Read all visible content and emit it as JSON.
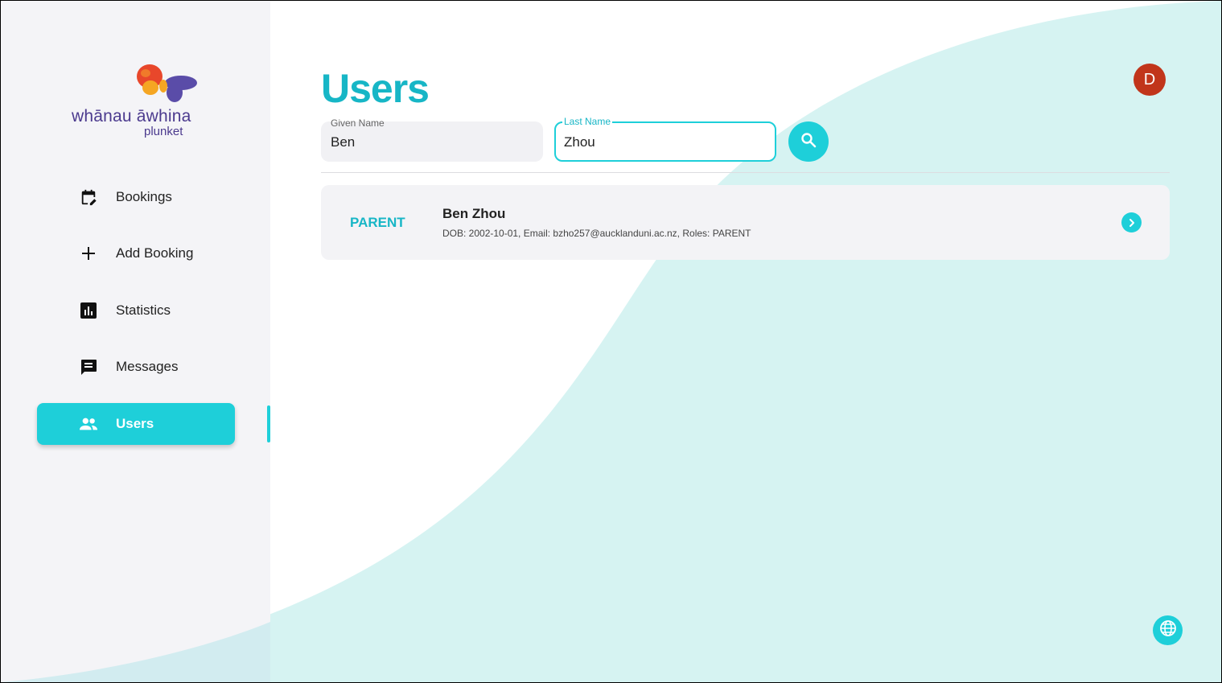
{
  "brand": {
    "line1": "whānau āwhina",
    "line2": "plunket"
  },
  "sidebar": {
    "items": [
      {
        "label": "Bookings",
        "icon": "calendar-edit-icon"
      },
      {
        "label": "Add Booking",
        "icon": "plus-icon"
      },
      {
        "label": "Statistics",
        "icon": "bar-chart-icon"
      },
      {
        "label": "Messages",
        "icon": "message-icon"
      },
      {
        "label": "Users",
        "icon": "people-icon",
        "active": true
      }
    ]
  },
  "header": {
    "title": "Users",
    "avatar_initial": "D"
  },
  "search": {
    "given_label": "Given Name",
    "given_value": "Ben",
    "last_label": "Last Name",
    "last_value": "Zhou"
  },
  "results": [
    {
      "role": "PARENT",
      "name": "Ben Zhou",
      "detail": "DOB: 2002-10-01, Email: bzho257@aucklanduni.ac.nz, Roles: PARENT"
    }
  ],
  "colors": {
    "accent": "#1ecfd9",
    "title": "#17b6c6",
    "avatar": "#c1351b",
    "brand": "#4b3a8e",
    "wave": "#d6f3f2"
  }
}
